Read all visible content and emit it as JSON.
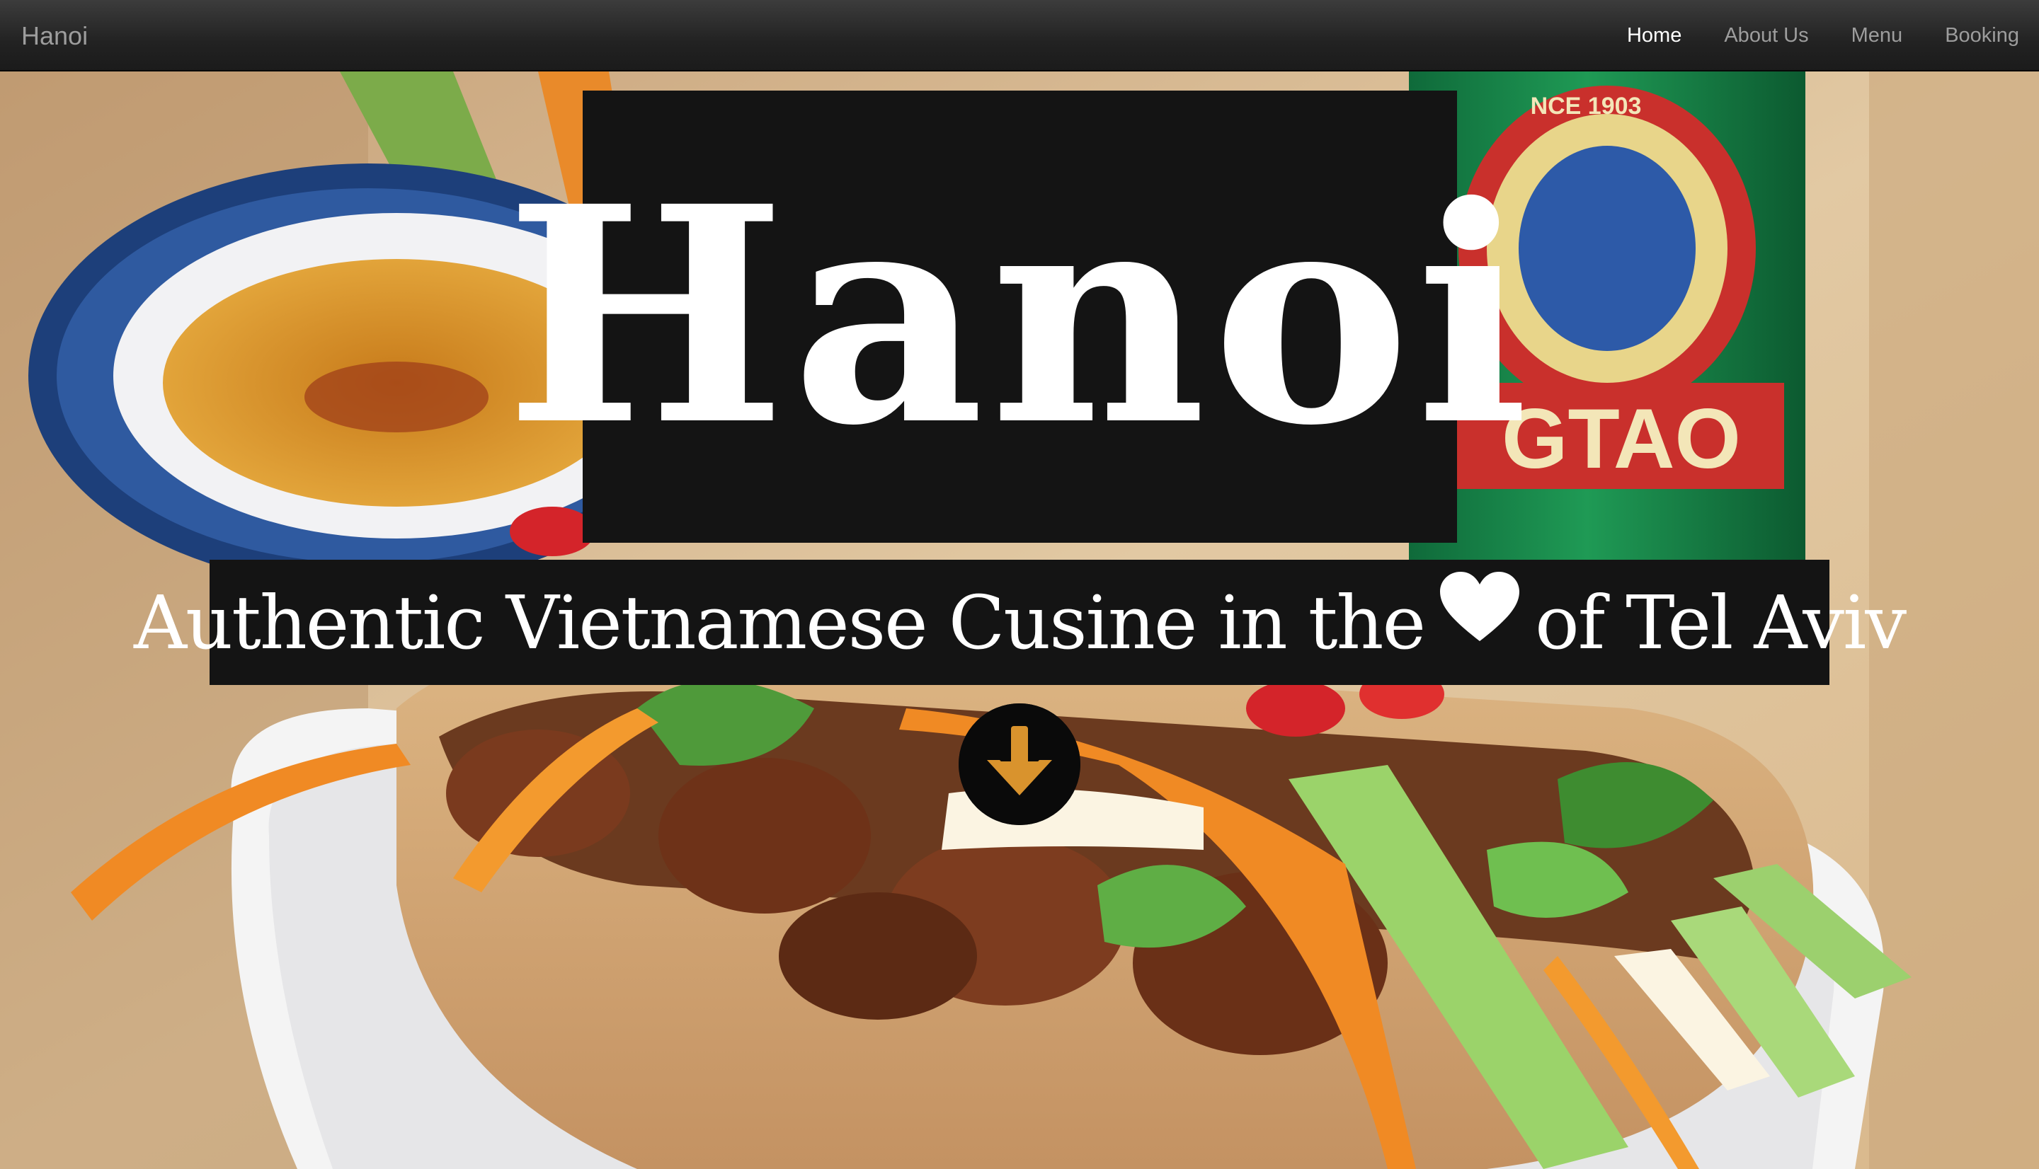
{
  "navbar": {
    "brand": "Hanoi",
    "items": [
      {
        "label": "Home",
        "active": true
      },
      {
        "label": "About Us",
        "active": false
      },
      {
        "label": "Menu",
        "active": false
      },
      {
        "label": "Booking",
        "active": false
      }
    ]
  },
  "hero": {
    "title": "Hanoi",
    "subtitle_before_icon": "Authentic Vietnamese Cusine in the",
    "subtitle_icon": "heart-icon",
    "subtitle_after_icon": "of Tel Aviv",
    "scroll_icon": "arrow-down-circle-icon",
    "background_image": "banh-mi-sandwich-photo",
    "beer_can_text": "GTAO",
    "beer_can_band_text": "NCE 1903"
  },
  "colors": {
    "navbar_bg": "#222222",
    "nav_text": "#9d9d9d",
    "nav_active": "#ffffff",
    "title_box_bg": "#141414",
    "title_text": "#ffffff"
  }
}
